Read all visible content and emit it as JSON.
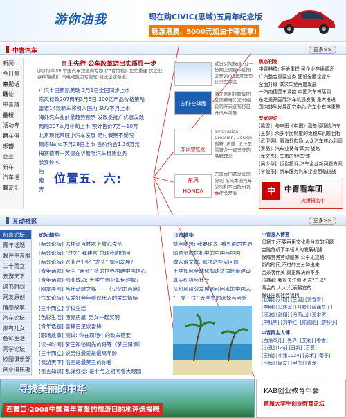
{
  "banner": {
    "logo": "游你油我",
    "line1": "现在购CIVIC(思域)五周年纪念版",
    "line2": "畅游港澳、5000元加油卡等您拿!"
  },
  "car_section": {
    "title": "中青汽车",
    "more": "更多>>",
    "nav": [
      "新闻",
      "今日焦点",
      "本期话题",
      "评论",
      "中青精品轩",
      "维权",
      "活动专题",
      "汽车俱乐部",
      "人物",
      "企业",
      "新车",
      "汽车谣录",
      "车友汇"
    ],
    "headline": "自主先行 公车改革迈出实质性一步",
    "summary": "[简介]2009 中国汽车频道周专题][中青特稿]: 拒绝重建 民企业存续境遇]广汽电动集团专业化 调迁企业新道]",
    "news": [
      "广汽丰田新凯美瑞 3月1日全国同步上市",
      "东风标致207两厢3月5日 200亿产品价格策略",
      "雷诺14款新车将引入国内 SUV下月上市",
      "海外汽车业前景趋势预示 发改委推广优惠发改",
      "两厢207本月中旬上市 预计售价7万—10万",
      "北京现代带旺小汽车发展 赔付假期不受限",
      "锡塔Nano下月28日上市 售价约合1.36万元",
      "梅赛德斯—英德在华着陆汽车租赁业务",
      "长安铃木",
      "物",
      "南",
      "奔"
    ],
    "mid_caption_1": "近日央视报道, 在一份网上调查中近期公开2008年度车型价汽车评选",
    "mid_caption_2": "浙江吉利控股集团公司董事长李书福公司昨天宣布将召开汽车发展",
    "mid_caption_3": "Innovation, Creation, Design 创新, 灵感, 设计是雪铁龙一直坚守的品牌理念",
    "mid_caption_4": "东风本田首发公司分司 东风本田汽车公司和本田技研发合作总开发",
    "thumb_label_geely": "吉利·全球鹰",
    "thumb_label_citroen": "东风雪铁龙",
    "thumb_label_dongfeng": "东风",
    "thumb_label_honda": "HONDA",
    "focus": {
      "title": "焦点刊物",
      "items": [
        "中青特稿: 拒绝重建 民企业存续调迁",
        "广汽整合重要业务 建设全面企业车",
        "全面升级 谋求车型再度发展",
        "一汽南德国车调控 中国汽车将落到",
        "东北重开国际汽车机遇发展 重大推进",
        "国内转型发展研究中心:汽车业有序重整"
      ]
    },
    "expert": {
      "title": "专家评论",
      "items": [
        "[梁震]: 与丰田《中国》副总经理谈汽车",
        "[王郡]: 众多平民制度的免税车问题目标",
        "[武卫强]: 看海外市场 大众汽车核心利润",
        "[罗磊]: 汽车业将有'四大'战略",
        "[龙文杰]: 车市的'停车'难",
        "[吴少华]: 诉讼投诉,汽车企业新问题方案",
        "[李锐乐]: 新车服务汽车企业面临挑战"
      ]
    },
    "ad_title": "中青看车团",
    "ad_sub": "火爆报名中"
  },
  "overlay": {
    "label": "位置五、六:"
  },
  "community": {
    "title": "互动社区",
    "more": "更多>>",
    "nav": [
      "热点论坛",
      "青年话题",
      "我评中青报",
      "三十而立",
      "云游天下",
      "读书时间",
      "网友原创",
      "情感故事",
      "汽车论坛",
      "家有儿女",
      "色彩生活",
      "同学论坛",
      "校园俱乐部",
      "创业俱乐部"
    ],
    "forum_title": "论坛精华",
    "forum_items": [
      "[两会论坛] 怎样让百姓吃上放心食品",
      "[两会论坛] \"过冬\" 我建言 总理我向你问",
      "[两会论坛] 农业产业化 \"龙头\" 如何发展?",
      "[青年话题] 全国 \"两会\" 将的世界构建中国信心",
      "[青年话题] 创业成功: 大学生创业如何理解?",
      "[网友原创] 当代诗歌之痛——《记忆的首席》",
      "[汽车论坛] 从爱狂奔年看现代人的爱车情结",
      "[三十而立] 学校生活",
      "[色彩生活] 漂亮房屋_男女一起买啊",
      "[青年话题] 雷锋日里谈雷锋",
      "[职场故事] 测试: 你在职场中的致命错要",
      "[读书时间] 梦王知秘闻先的奇等《梦兰阳课》",
      "[三十而立] 说男性最爱是最高年龄",
      "[云游天下] 浴室是最美丑的你看",
      "[引言知识] 乱弹红楼: 是非与之相问看大观园"
    ],
    "blog_title": "日志精华",
    "blog_items": [
      "姚明随想: 我要理去, 看外面的世界",
      "随意金融危机中的中国与中国",
      "做人得文章, 解决这些实问题",
      "土地如何全球化加速法律制度建设",
      "真实积极与社会",
      "从热风研究发展到可回来的中国人",
      "\"三支一扶\" 大学生的选择与考验"
    ],
    "blog_img_caption": "",
    "rp_title": "中青报人博客",
    "rp_items": [
      "冯斌丁:不要再用文化看台前的问题",
      "金融危机下年轻人的发展机遇",
      "保障劳务劳动服务 公平无规划",
      "新的时间,不过的三分钟出来",
      "苦茶客伴美 真正解决的不多",
      "[周锦]: 我很关注你 不这\"三以\"",
      "两会的 人大,代表最宜的",
      "保证出现社会福利"
    ],
    "tags": [
      "[崔馨]  [刘刚]  [王国] [贾春青]",
      "[李明]  [冯晓军] [叮铃]  [阔疆东子]",
      "[汪波]  [彭翔] [冯高山] [王宇贺]",
      "[中钰宇]  [刘学红] [陈德刚]  [游客小]"
    ],
    "hot_title": "中青网主人博",
    "hot_items": [
      "[西落本儿] [黑界]  [艾莉]  [春香]",
      "[小丑] [tag] [日新] [音恩]",
      "[王楠]  [小猪1024] [苏禾] [菊子]",
      "[小鱼] [网友] [甲虫]  [青龙]"
    ]
  },
  "bottom_banner": {
    "left_title": "寻找美丽的中华",
    "left_sub": "西霞口·2008中国青年喜爱的旅游目的地评选揭晓",
    "right_title": "KAB创业教育年会",
    "right_sub": "首届大学生创业教育论坛"
  }
}
